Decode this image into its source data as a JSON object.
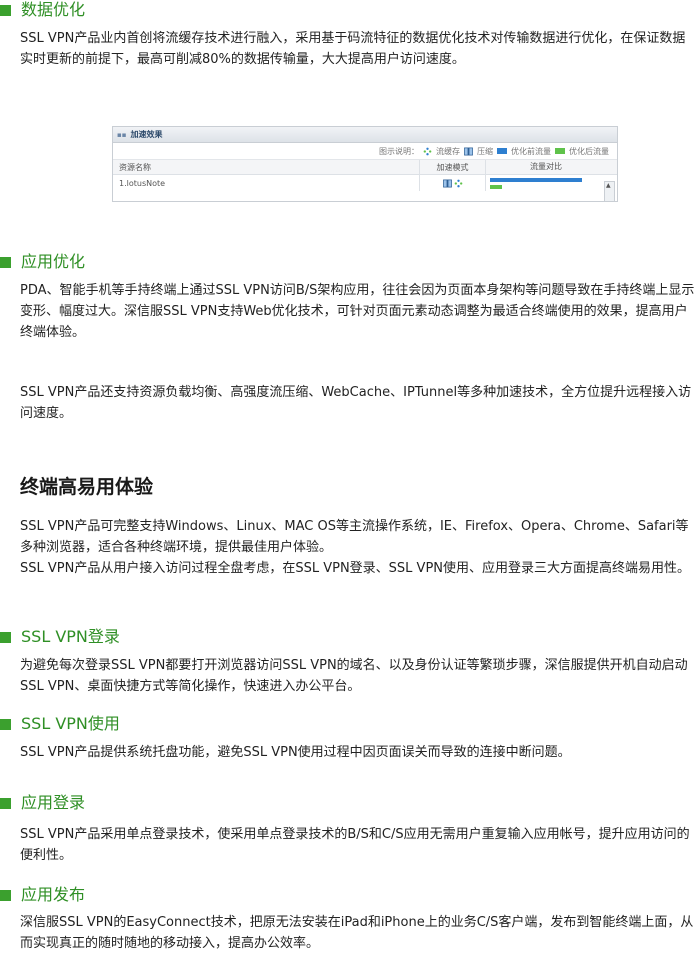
{
  "sections": {
    "data_opt": {
      "title": "数据优化",
      "para": "SSL VPN产品业内首创将流缓存技术进行融入，采用基于码流特征的数据优化技术对传输数据进行优化，在保证数据实时更新的前提下，最高可削减80%的数据传输量，大大提高用户访问速度。"
    },
    "app_opt": {
      "title": "应用优化",
      "para1": "PDA、智能手机等手持终端上通过SSL VPN访问B/S架构应用，往往会因为页面本身架构等问题导致在手持终端上显示变形、幅度过大。深信服SSL VPN支持Web优化技术，可针对页面元素动态调整为最适合终端使用的效果，提高用户终端体验。",
      "para2": "SSL VPN产品还支持资源负载均衡、高强度流压缩、WebCache、IPTunnel等多种加速技术，全方位提升远程接入访问速度。"
    },
    "terminal": {
      "title": "终端高易用体验",
      "para1": "SSL VPN产品可完整支持Windows、Linux、MAC OS等主流操作系统，IE、Firefox、Opera、Chrome、Safari等多种浏览器，适合各种终端环境，提供最佳用户体验。",
      "para2": "SSL VPN产品从用户接入访问过程全盘考虑，在SSL VPN登录、SSL VPN使用、应用登录三大方面提高终端易用性。"
    },
    "login": {
      "title": "SSL VPN登录",
      "para": "为避免每次登录SSL VPN都要打开浏览器访问SSL VPN的域名、以及身份认证等繁琐步骤，深信服提供开机自动启动SSL VPN、桌面快捷方式等简化操作，快速进入办公平台。"
    },
    "use": {
      "title": "SSL VPN使用",
      "para": "SSL VPN产品提供系统托盘功能，避免SSL VPN使用过程中因页面误关而导致的连接中断问题。"
    },
    "app_login": {
      "title": "应用登录",
      "para": "SSL VPN产品采用单点登录技术，使采用单点登录技术的B/S和C/S应用无需用户重复输入应用帐号，提升应用访问的便利性。"
    },
    "app_publish": {
      "title": "应用发布",
      "para": "深信服SSL VPN的EasyConnect技术，把原无法安装在iPad和iPhone上的业务C/S客户端，发布到智能终端上面，从而实现真正的随时随地的移动接入，提高办公效率。"
    }
  },
  "panel": {
    "title": "加速效果",
    "legend_label": "图示说明：",
    "legend_items": [
      "流缓存",
      "压缩",
      "优化前流量",
      "优化后流量"
    ],
    "col_resource": "资源名称",
    "col_mode": "加速模式",
    "col_compare": "流量对比",
    "row_name": "1.lotusNote"
  },
  "colors": {
    "accent_green": "#3ba02e",
    "bar_before": "#2e7fd0",
    "bar_after": "#5fc24a"
  }
}
